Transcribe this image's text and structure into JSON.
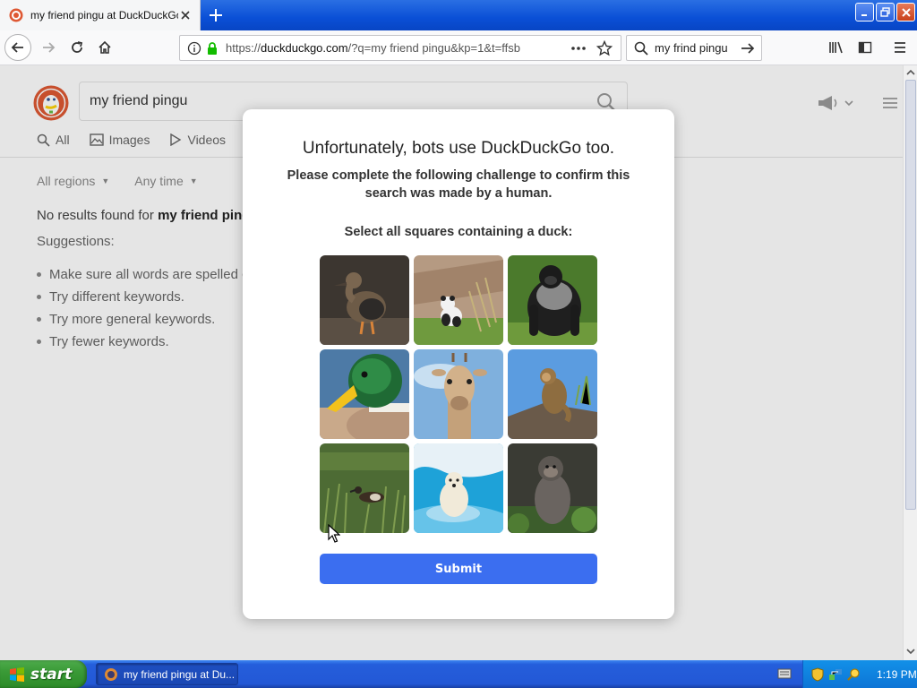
{
  "browser": {
    "tab_title": "my friend pingu at DuckDuckGo",
    "url_prefix": "https://",
    "url_host": "duckduckgo.com",
    "url_rest": "/?q=my friend pingu&kp=1&t=ffsb",
    "search_box_value": "my frind pingu"
  },
  "ddg": {
    "search_value": "my friend pingu",
    "tabs": [
      {
        "label": "All",
        "icon": "search-icon"
      },
      {
        "label": "Images",
        "icon": "image-icon"
      },
      {
        "label": "Videos",
        "icon": "play-icon"
      }
    ],
    "filters": [
      "All regions",
      "Any time"
    ],
    "no_results_prefix": "No results found for ",
    "no_results_query": "my friend pingu",
    "suggestions_label": "Suggestions:",
    "suggestions": [
      "Make sure all words are spelled correctly.",
      "Try different keywords.",
      "Try more general keywords.",
      "Try fewer keywords."
    ]
  },
  "challenge": {
    "title": "Unfortunately, bots use DuckDuckGo too.",
    "description": "Please complete the following challenge to confirm this search was made by a human.",
    "prompt": "Select all squares containing a duck:",
    "tiles": [
      {
        "subject": "duck"
      },
      {
        "subject": "panda"
      },
      {
        "subject": "gorilla"
      },
      {
        "subject": "mallard duck"
      },
      {
        "subject": "giraffe"
      },
      {
        "subject": "monkey"
      },
      {
        "subject": "duck in grass"
      },
      {
        "subject": "polar bear"
      },
      {
        "subject": "monkey"
      }
    ],
    "submit_label": "Submit"
  },
  "taskbar": {
    "start_label": "start",
    "task_label": "my friend pingu at Du...",
    "clock": "1:19 PM"
  },
  "colors": {
    "accent": "#3b6ef0",
    "xp_blue": "#245edb",
    "xp_green": "#3a9a37"
  }
}
